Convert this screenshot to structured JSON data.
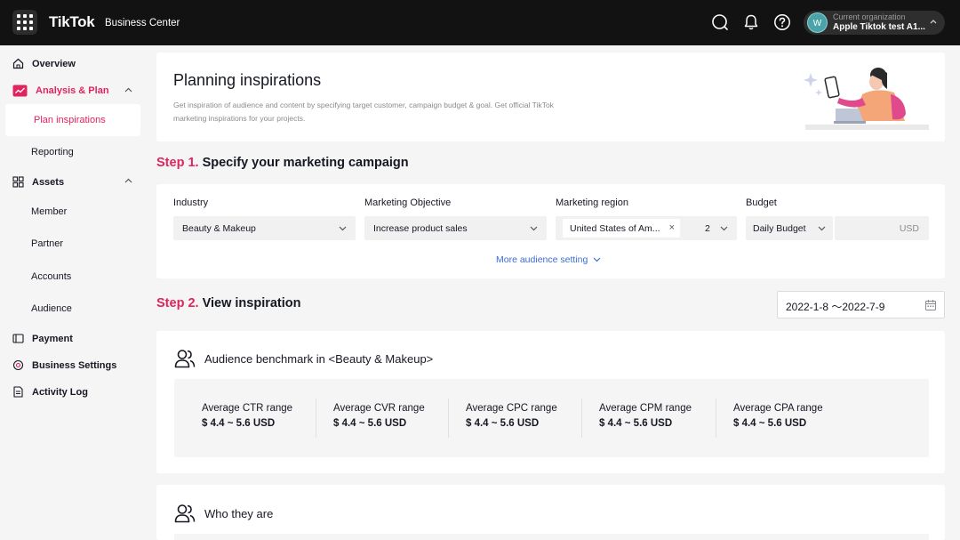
{
  "topbar": {
    "logo": "TikTok",
    "logo_sub": "Business Center",
    "org_caption": "Current organization",
    "org_name": "Apple Tiktok test A1...",
    "org_avatar": "W"
  },
  "sidebar": {
    "overview": "Overview",
    "analysis": "Analysis & Plan",
    "plan_inspirations": "Plan inspirations",
    "reporting": "Reporting",
    "assets": "Assets",
    "member": "Member",
    "partner": "Partner",
    "accounts": "Accounts",
    "audience": "Audience",
    "payment": "Payment",
    "business_settings": "Business Settings",
    "activity_log": "Activity Log"
  },
  "header": {
    "title": "Planning inspirations",
    "description": "Get inspiration of audience and content by specifying target customer, campaign budget & goal. Get official TikTok marketing inspirations for your projects."
  },
  "step1": {
    "num": "Step 1.",
    "title": "Specify your marketing campaign",
    "industry_label": "Industry",
    "industry_value": "Beauty & Makeup",
    "objective_label": "Marketing Objective",
    "objective_value": "Increase product sales",
    "region_label": "Marketing region",
    "region_tag": "United States of Am...",
    "region_count": "2",
    "budget_label": "Budget",
    "budget_type": "Daily Budget",
    "budget_currency": "USD",
    "more_link": "More audience setting"
  },
  "step2": {
    "num": "Step 2.",
    "title": "View inspiration",
    "date_range": "2022-1-8 ～2022-7-9"
  },
  "benchmark": {
    "title": "Audience benchmark in <Beauty & Makeup>",
    "metrics": [
      {
        "label": "Average CTR range",
        "value": "$ 4.4 ~ 5.6 USD"
      },
      {
        "label": "Average CVR range",
        "value": "$ 4.4 ~ 5.6 USD"
      },
      {
        "label": "Average CPC range",
        "value": "$ 4.4 ~ 5.6 USD"
      },
      {
        "label": "Average CPM range",
        "value": "$ 4.4 ~ 5.6 USD"
      },
      {
        "label": "Average CPA range",
        "value": "$ 4.4 ~ 5.6 USD"
      }
    ]
  },
  "who": {
    "title": "Who they are"
  },
  "colors": {
    "accent": "#e0245e",
    "link": "#3d6bd8",
    "topbar": "#121212"
  },
  "icons": [
    "apps-grid-icon",
    "search-icon",
    "bell-icon",
    "help-icon",
    "chevron-up-icon",
    "home-icon",
    "chart-icon",
    "assets-icon",
    "payment-icon",
    "settings-icon",
    "log-icon",
    "calendar-icon",
    "people-icon"
  ]
}
